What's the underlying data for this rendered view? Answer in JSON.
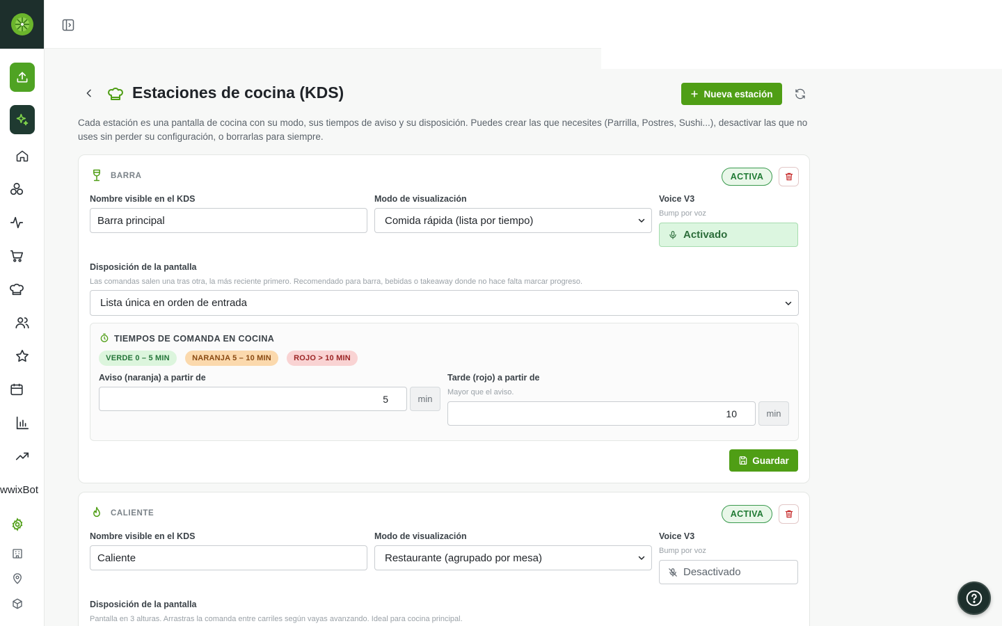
{
  "page": {
    "title": "Estaciones de cocina (KDS)",
    "new_station_label": "Nueva estación",
    "description": "Cada estación es una pantalla de cocina con su modo, sus tiempos de aviso y su disposición. Puedes crear las que necesites (Parrilla, Postres, Sushi...), desactivar las que no uses sin perder su configuración, o borrarlas para siempre."
  },
  "sidebar": {
    "brand_text": "wwixBot"
  },
  "stations": [
    {
      "name": "BARRA",
      "status": "ACTIVA",
      "display_name_label": "Nombre visible en el KDS",
      "display_name_value": "Barra principal",
      "mode_label": "Modo de visualización",
      "mode_value": "Comida rápida (lista por tiempo)",
      "voice_label": "Voice V3",
      "voice_sub": "Bump por voz",
      "voice_state": "Activado",
      "layout_label": "Disposición de la pantalla",
      "layout_help": "Las comandas salen una tras otra, la más reciente primero. Recomendado para barra, bebidas o takeaway donde no hace falta marcar progreso.",
      "layout_value": "Lista única en orden de entrada",
      "times": {
        "title": "TIEMPOS DE COMANDA EN COCINA",
        "pill_green": "VERDE 0 – 5 MIN",
        "pill_orange": "NARANJA 5 – 10 MIN",
        "pill_red": "ROJO > 10 MIN",
        "warn_label": "Aviso (naranja) a partir de",
        "warn_value": "5",
        "late_label": "Tarde (rojo) a partir de",
        "late_help": "Mayor que el aviso.",
        "late_value": "10",
        "unit": "min"
      },
      "save_label": "Guardar"
    },
    {
      "name": "CALIENTE",
      "status": "ACTIVA",
      "display_name_label": "Nombre visible en el KDS",
      "display_name_value": "Caliente",
      "mode_label": "Modo de visualización",
      "mode_value": "Restaurante (agrupado por mesa)",
      "voice_label": "Voice V3",
      "voice_sub": "Bump por voz",
      "voice_state": "Desactivado",
      "layout_label": "Disposición de la pantalla",
      "layout_help": "Pantalla en 3 alturas. Arrastras la comanda entre carriles según vayas avanzando. Ideal para cocina principal."
    }
  ],
  "colors": {
    "primary": "#4f9e15",
    "sidebar_dark": "#1d2f2c",
    "active_badge": "#3a9a4e",
    "danger": "#c62828"
  }
}
